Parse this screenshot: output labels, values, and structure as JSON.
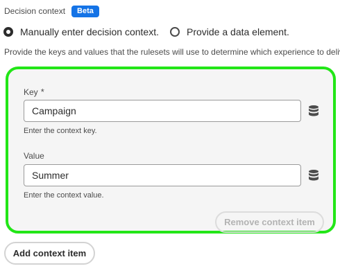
{
  "header": {
    "label": "Decision context",
    "badge": "Beta"
  },
  "mode": {
    "options": [
      {
        "label": "Manually enter decision context.",
        "selected": true
      },
      {
        "label": "Provide a data element.",
        "selected": false
      }
    ]
  },
  "description": "Provide the keys and values that the rulesets will use to determine which experience to deliver.",
  "context_item": {
    "key": {
      "label": "Key",
      "required_marker": "*",
      "value": "Campaign",
      "help": "Enter the context key.",
      "icon": "database-icon"
    },
    "value": {
      "label": "Value",
      "value": "Summer",
      "help": "Enter the context value.",
      "icon": "database-icon"
    },
    "remove_label": "Remove context item"
  },
  "add_label": "Add context item",
  "colors": {
    "accent": "#1473e6",
    "highlight_border": "#22e617"
  }
}
